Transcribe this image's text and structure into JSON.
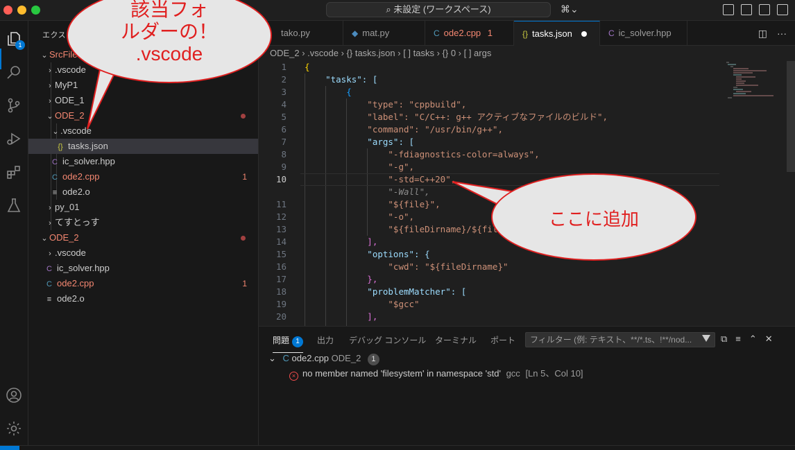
{
  "titlebar": {
    "nav": "← →",
    "command_center": "⌕ 未設定 (ワークスペース)",
    "copilot": "⌘⌄"
  },
  "activity": {
    "explorer_badge": "1"
  },
  "sidebar": {
    "header": "エクス",
    "root": "SrcFile",
    "tree": [
      {
        "label": ".vscode",
        "chev": "›",
        "icon": ""
      },
      {
        "label": "MyP1",
        "chev": "›",
        "icon": ""
      },
      {
        "label": "ODE_1",
        "chev": "›",
        "icon": ""
      },
      {
        "label": "ODE_2",
        "chev": "⌄",
        "icon": ""
      },
      {
        "label": ".vscode",
        "chev": "⌄",
        "icon": ""
      },
      {
        "label": "tasks.json",
        "chev": "",
        "icon": "{}"
      },
      {
        "label": "ic_solver.hpp",
        "chev": "",
        "icon": "C"
      },
      {
        "label": "ode2.cpp",
        "chev": "",
        "icon": "C",
        "count": "1"
      },
      {
        "label": "ode2.o",
        "chev": "",
        "icon": "≡"
      },
      {
        "label": "py_01",
        "chev": "›",
        "icon": ""
      },
      {
        "label": "てすとっす",
        "chev": "›",
        "icon": ""
      },
      {
        "label": "ODE_2",
        "chev": "⌄",
        "icon": ""
      },
      {
        "label": ".vscode",
        "chev": "›",
        "icon": ""
      },
      {
        "label": "ic_solver.hpp",
        "chev": "",
        "icon": "C"
      },
      {
        "label": "ode2.cpp",
        "chev": "",
        "icon": "C",
        "count": "1"
      },
      {
        "label": "ode2.o",
        "chev": "",
        "icon": "≡"
      }
    ]
  },
  "tabs": [
    {
      "label": "tako.py",
      "icon": "",
      "count": ""
    },
    {
      "label": "mat.py",
      "icon": "◆",
      "count": ""
    },
    {
      "label": "ode2.cpp",
      "icon": "C",
      "count": "1"
    },
    {
      "label": "tasks.json",
      "icon": "{}",
      "count": ""
    },
    {
      "label": "ic_solver.hpp",
      "icon": "C",
      "count": ""
    }
  ],
  "breadcrumb": "ODE_2 › .vscode › {} tasks.json › [ ] tasks › {} 0 › [ ] args",
  "editor": {
    "lines": [
      {
        "n": "1",
        "text": "{"
      },
      {
        "n": "2",
        "text": "    \"tasks\": ["
      },
      {
        "n": "3",
        "text": "        {"
      },
      {
        "n": "4",
        "text": "            \"type\": \"cppbuild\","
      },
      {
        "n": "5",
        "text": "            \"label\": \"C/C++: g++ アクティブなファイルのビルド\","
      },
      {
        "n": "6",
        "text": "            \"command\": \"/usr/bin/g++\","
      },
      {
        "n": "7",
        "text": "            \"args\": ["
      },
      {
        "n": "8",
        "text": "                \"-fdiagnostics-color=always\","
      },
      {
        "n": "9",
        "text": "                \"-g\","
      },
      {
        "n": "10",
        "text": "                \"-std=C++20\","
      },
      {
        "n": "",
        "text": "                \"-Wall\","
      },
      {
        "n": "11",
        "text": "                \"${file}\","
      },
      {
        "n": "12",
        "text": "                \"-o\","
      },
      {
        "n": "13",
        "text": "                \"${fileDirname}/${file"
      },
      {
        "n": "14",
        "text": "            ],"
      },
      {
        "n": "15",
        "text": "            \"options\": {"
      },
      {
        "n": "16",
        "text": "                \"cwd\": \"${fileDirname}\""
      },
      {
        "n": "17",
        "text": "            },"
      },
      {
        "n": "18",
        "text": "            \"problemMatcher\": ["
      },
      {
        "n": "19",
        "text": "                \"$gcc\""
      },
      {
        "n": "20",
        "text": "            ],"
      }
    ]
  },
  "panel": {
    "tabs": [
      "問題",
      "出力",
      "デバッグ コンソール",
      "ターミナル",
      "ポート"
    ],
    "problems_badge": "1",
    "filter_placeholder": "フィルター (例: テキスト、**/*.ts、!**/nod...",
    "file": "ode2.cpp",
    "folder": "ODE_2",
    "file_count": "1",
    "message": "no member named 'filesystem' in namespace 'std'",
    "source": "gcc",
    "location": "[Ln 5、Col 10]"
  },
  "annotations": {
    "top": "該当フォ\nルダーの！\n.vscode",
    "right": "ここに追加"
  }
}
